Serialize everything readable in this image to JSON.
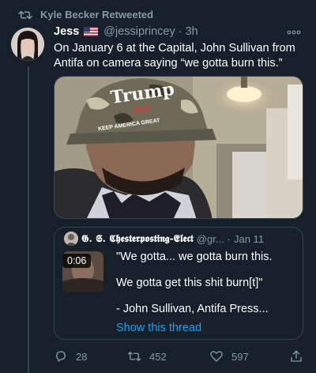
{
  "retweet_banner": {
    "label": "Kyle Becker Retweeted",
    "icon": "retweet-icon"
  },
  "tweet": {
    "author_name": "Jess",
    "handle": "@jessiprincey",
    "separator": "·",
    "time": "3h",
    "text": "On January 6 at the Capital, John Sullivan from Antifa on camera saying “we gotta burn this.”",
    "media_alt_icon": "photo",
    "more_icon": "more-icon"
  },
  "quote": {
    "author_name": "𝕲. 𝕾. 𝕮𝖍𝖊𝖘𝖙𝖊𝖗𝖕𝖔𝖘𝖙𝖎𝖓𝖌-𝕰𝖑𝖊𝖈𝖙",
    "handle": "@gr...",
    "separator": "·",
    "time": "Jan 11",
    "video_duration": "0:06",
    "lines": [
      "\"We gotta... we gotta burn this.",
      "We gotta get this shit burn[t]\"",
      "- John Sullivan, Antifa Press..."
    ],
    "show_thread": "Show this thread"
  },
  "actions": {
    "reply_count": "28",
    "retweet_count": "452",
    "like_count": "597"
  },
  "colors": {
    "background": "#15202b",
    "secondary_text": "#8899a6",
    "link": "#1da1f2",
    "border": "#38444d"
  }
}
